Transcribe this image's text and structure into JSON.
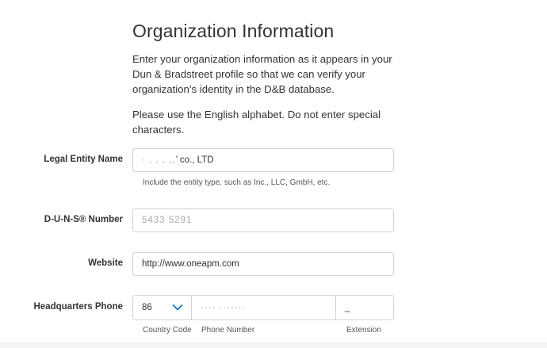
{
  "header": {
    "title": "Organization Information"
  },
  "intro": {
    "paragraph1": "Enter your organization information as it appears in your Dun & Bradstreet profile so that we can verify your organization’s identity in the D&B database.",
    "paragraph2": "Please use the English alphabet. Do not enter special characters."
  },
  "form": {
    "legal_entity": {
      "label": "Legal Entity Name",
      "value_redacted": "· ,  ,        ,        ,,",
      "value_suffix": "’ co., LTD",
      "hint": "Include the entity type, such as Inc., LLC, GmbH, etc."
    },
    "duns": {
      "label": "D-U-N-S® Number",
      "value_redacted": "5433 5291"
    },
    "website": {
      "label": "Website",
      "value": "http://www.oneapm.com"
    },
    "phone": {
      "label": "Headquarters Phone",
      "country_code": "86",
      "country_code_caption": "Country Code",
      "number_redacted": "···· ·······",
      "number_caption": "Phone Number",
      "extension": "_",
      "extension_caption": "Extension"
    }
  },
  "colors": {
    "text": "#333333",
    "border": "#d2d2d7",
    "accent": "#0070c9"
  }
}
